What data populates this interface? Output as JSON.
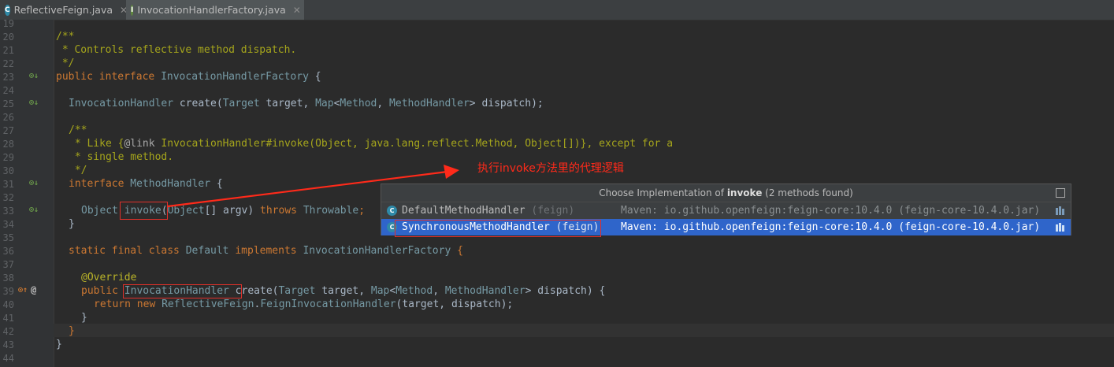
{
  "tabs": [
    {
      "label": "ReflectiveFeign.java",
      "icon": "class-file-icon",
      "active": false
    },
    {
      "label": "InvocationHandlerFactory.java",
      "icon": "interface-file-icon",
      "active": true
    }
  ],
  "line_numbers": [
    "19",
    "20",
    "21",
    "22",
    "23",
    "24",
    "25",
    "26",
    "27",
    "28",
    "29",
    "30",
    "31",
    "32",
    "33",
    "34",
    "35",
    "36",
    "37",
    "38",
    "39",
    "40",
    "41",
    "42",
    "43",
    "44"
  ],
  "code": {
    "l20": "/**",
    "l21": " * Controls reflective method dispatch.",
    "l22": " */",
    "l23": [
      "public interface ",
      "InvocationHandlerFactory",
      " {"
    ],
    "l25": [
      "InvocationHandler",
      " create(",
      "Target",
      " target, ",
      "Map",
      "<",
      "Method",
      ", ",
      "MethodHandler",
      "> dispatch);"
    ],
    "l27": "/**",
    "l28": [
      " * Like {",
      "@link",
      " InvocationHandler#invoke(Object, java.lang.reflect.Method, Object[])}, except for a"
    ],
    "l29": " * single method.",
    "l30": " */",
    "l31": [
      "interface ",
      "MethodHandler",
      " {"
    ],
    "l33": [
      "Object",
      " ",
      "invoke",
      "(",
      "Object",
      "[] argv) ",
      "throws ",
      "Throwable",
      ";"
    ],
    "l34": "}",
    "l36": [
      "static final class ",
      "Default ",
      "implements ",
      "InvocationHandlerFactory",
      " {"
    ],
    "l38": "@Override",
    "l39": [
      "public ",
      "InvocationHandler",
      " create(",
      "Target",
      " target, ",
      "Map",
      "<",
      "Method",
      ", ",
      "MethodHandler",
      "> dispatch) {"
    ],
    "l40": [
      "return new ",
      "ReflectiveFeign",
      ".",
      "FeignInvocationHandler",
      "(target, dispatch);"
    ],
    "l41": "}",
    "l42": "}",
    "l43": "}"
  },
  "popup": {
    "title_prefix": "Choose Implementation of ",
    "title_method": "invoke",
    "title_suffix": " (2 methods found)",
    "items": [
      {
        "name": "DefaultMethodHandler",
        "pkg": " (feign)",
        "maven": "Maven: io.github.openfeign:feign-core:10.4.0 (feign-core-10.4.0.jar)"
      },
      {
        "name": "SynchronousMethodHandler",
        "pkg": " (feign)",
        "maven": "Maven: io.github.openfeign:feign-core:10.4.0 (feign-core-10.4.0.jar)"
      }
    ]
  },
  "annotation": "执行invoke方法里的代理逻辑",
  "colors": {
    "annotation": "#ff2a1a",
    "selection": "#2f65ca",
    "keyword": "#cc7832"
  }
}
